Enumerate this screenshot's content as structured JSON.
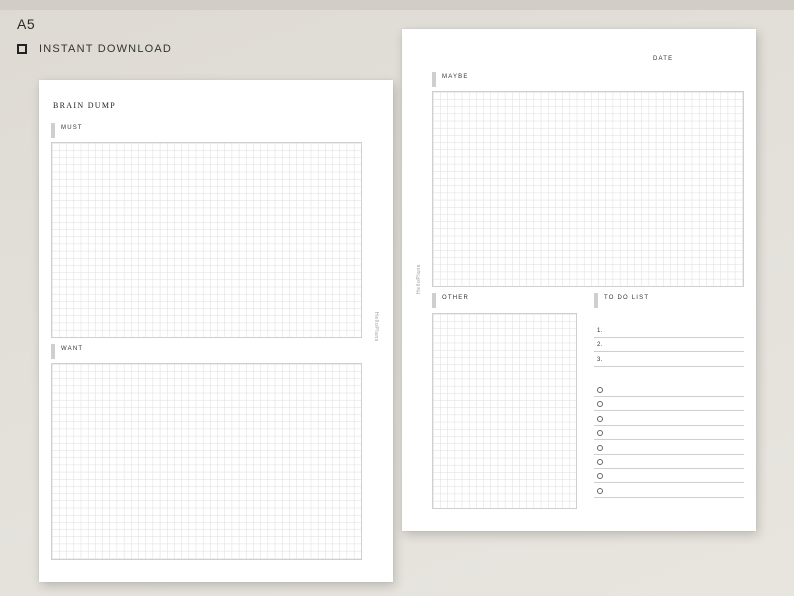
{
  "header": {
    "size": "A5",
    "download_text": "INSTANT DOWNLOAD"
  },
  "left_page": {
    "title": "BRAIN DUMP",
    "section_1": "MUST",
    "section_2": "WANT",
    "brand": "HelloPlans"
  },
  "right_page": {
    "date_label": "DATE",
    "section_maybe": "MAYBE",
    "section_other": "OTHER",
    "section_todo": "TO DO LIST",
    "brand": "HelloPlans",
    "numbered_items": [
      "1.",
      "2.",
      "3."
    ],
    "checkbox_count": 8
  },
  "colors": {
    "background": "#e3e0da",
    "grid_line": "#dcdcdc",
    "label_bar": "#cfcfcf"
  }
}
